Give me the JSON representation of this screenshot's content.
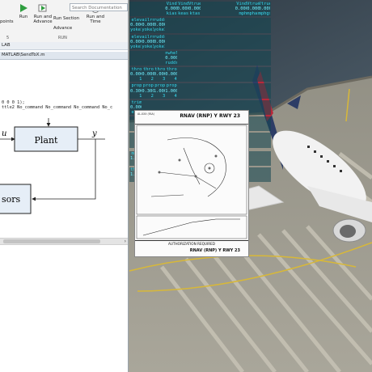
{
  "matlab": {
    "search_placeholder": "Search Documentation",
    "toolbar": {
      "left_partial": "points",
      "run": "Run",
      "run_and_advance_1": "Run and",
      "run_and_advance_2": "Advance",
      "run_section": "Run Section",
      "advance": "Advance",
      "run_and_time_1": "Run and",
      "run_and_time_2": "Time"
    },
    "toolstrip_section_left": "5",
    "toolstrip_section_right": "RUN",
    "path": "LAB",
    "file_tab": "MATLAB\\SendToX.m",
    "code_lines": [
      "0 0 0 1);",
      "ttle2 No_command No_command No_command No_c"
    ],
    "diagram": {
      "input_label": "u",
      "output_label": "y",
      "plant_label": "Plant",
      "sensor_label": "sors"
    }
  },
  "data_output": {
    "blocks": [
      {
        "headers": [
          "",
          "",
          "",
          "Vind",
          "Vind",
          "Vtrue",
          "",
          "",
          "",
          "Vind",
          "Vtrue",
          "Vtrue"
        ],
        "values": [
          "",
          "",
          "",
          "0.0001",
          "0.0001",
          "0.0001",
          "",
          "",
          "",
          "0.0000",
          "0.0000",
          "0.0000"
        ],
        "units": [
          "",
          "",
          "",
          "kias",
          "keas",
          "ktas",
          "",
          "",
          "",
          "mph",
          "mphas",
          "mphgs"
        ]
      },
      {
        "headers": [
          "elev",
          "ailrn",
          "ruddr",
          "",
          "",
          "",
          "",
          "",
          "",
          "",
          "",
          ""
        ],
        "values": [
          "0.0000",
          "0.0000",
          "0.0000",
          "",
          "",
          "",
          "",
          "",
          "",
          "",
          "",
          ""
        ],
        "units": [
          "yoke1",
          "yoke1",
          "yoke1",
          "",
          "",
          "",
          "",
          "",
          "",
          "",
          "",
          ""
        ]
      },
      {
        "headers": [
          "elev",
          "ailrn",
          "ruddr",
          "",
          "",
          "",
          "",
          "",
          "",
          "",
          "",
          ""
        ],
        "values": [
          "0.0000",
          "0.0000",
          "0.0000",
          "",
          "",
          "",
          "",
          "",
          "",
          "",
          "",
          ""
        ],
        "units": [
          "yoke1",
          "yoke1",
          "yoke1",
          "",
          "",
          "",
          "",
          "",
          "",
          "",
          "",
          ""
        ]
      },
      {
        "headers": [
          "",
          "",
          "",
          "nwhel",
          "",
          "",
          "",
          "",
          "",
          "",
          "",
          ""
        ],
        "values": [
          "",
          "",
          "",
          "0.0000",
          "",
          "",
          "",
          "",
          "",
          "",
          "",
          ""
        ],
        "units": [
          "",
          "",
          "",
          "ruddr",
          "",
          "",
          "",
          "",
          "",
          "",
          "",
          ""
        ]
      },
      {
        "headers": [
          "thro",
          "thro",
          "thro",
          "thro",
          "",
          "",
          "",
          "",
          "",
          "",
          "",
          ""
        ],
        "values": [
          "0.0000",
          "0.0000",
          "0.0000",
          "0.0000",
          "",
          "",
          "",
          "",
          "",
          "",
          "",
          ""
        ],
        "units": [
          "1",
          "2",
          "3",
          "4",
          "",
          "",
          "",
          "",
          "",
          "",
          "",
          ""
        ]
      },
      {
        "headers": [
          "prop",
          "prop",
          "prop",
          "prop",
          "",
          "",
          "",
          "",
          "",
          "",
          "",
          ""
        ],
        "values": [
          "0.3000",
          "0.3000",
          "1.0000",
          "1.0000",
          "",
          "",
          "",
          "",
          "",
          "",
          "",
          ""
        ],
        "units": [
          "1",
          "2",
          "3",
          "4",
          "",
          "",
          "",
          "",
          "",
          "",
          "",
          ""
        ]
      },
      {
        "headers": [
          "trim",
          "",
          "",
          "",
          "",
          "",
          "",
          "",
          "",
          "",
          "",
          ""
        ],
        "values": [
          "0.0000",
          "",
          "",
          "",
          "",
          "",
          "",
          "",
          "",
          "",
          "",
          ""
        ],
        "units": [
          "elev",
          "",
          "",
          "",
          "",
          "",
          "",
          "",
          "",
          "",
          "",
          ""
        ]
      },
      {
        "headers": [
          "",
          "",
          "",
          "flaps",
          "",
          "",
          "",
          "",
          "",
          "",
          "",
          ""
        ],
        "values": [
          "",
          "",
          "",
          "0.0000",
          "",
          "",
          "",
          "",
          "",
          "",
          "",
          ""
        ],
        "units": [
          "",
          "",
          "",
          "handl",
          "",
          "",
          "",
          "",
          "",
          "",
          "",
          ""
        ]
      },
      {
        "headers": [
          "",
          "",
          "",
          "",
          "",
          "slrat",
          "",
          "",
          "",
          "",
          "",
          ""
        ],
        "values": [
          "",
          "",
          "",
          "",
          "",
          "0.0000",
          "",
          "",
          "",
          "",
          "",
          ""
        ],
        "units": [
          "",
          "",
          "",
          "",
          "",
          "ratio",
          "",
          "",
          "",
          "",
          "",
          ""
        ]
      },
      {
        "headers": [
          "",
          "",
          "",
          "",
          "",
          "",
          "",
          "",
          "",
          "",
          "",
          ""
        ],
        "values": [
          "",
          "",
          "",
          "",
          "",
          "",
          "",
          "",
          "",
          "",
          "",
          ""
        ],
        "units": [
          "",
          "",
          "",
          "",
          "",
          "",
          "",
          "",
          "",
          "",
          "",
          ""
        ]
      },
      {
        "headers": [
          "mixt",
          "mixt",
          "",
          "",
          "",
          "",
          "",
          "",
          "",
          "",
          "",
          ""
        ],
        "values": [
          "1.0000",
          "1.0000",
          "",
          "",
          "",
          "",
          "",
          "",
          "",
          "",
          "",
          ""
        ],
        "units": [
          "1",
          "2",
          "",
          "",
          "",
          "",
          "",
          "",
          "",
          "",
          "",
          ""
        ]
      },
      {
        "headers": [
          "throt",
          "throt",
          "",
          "",
          "",
          "",
          "",
          "",
          "",
          "",
          "",
          ""
        ],
        "values": [
          "1.0070",
          "1.0070",
          "",
          "",
          "",
          "",
          "",
          "",
          "",
          "",
          "",
          ""
        ],
        "units": [
          "1",
          "2",
          "",
          "",
          "",
          "",
          "",
          "",
          "",
          "",
          "",
          ""
        ]
      }
    ]
  },
  "approach_chart": {
    "title": "RNAV (RNP) Y RWY 23",
    "title_foot": "RNAV (RNP) Y RWY 23",
    "auth_text": "AUTHORIZATION REQUIRED",
    "header_small": "AL-XXX (FAA)"
  },
  "colors": {
    "data_text": "#36d8ee",
    "plant_fill": "#e6eef7",
    "water": "#3b4a58"
  }
}
